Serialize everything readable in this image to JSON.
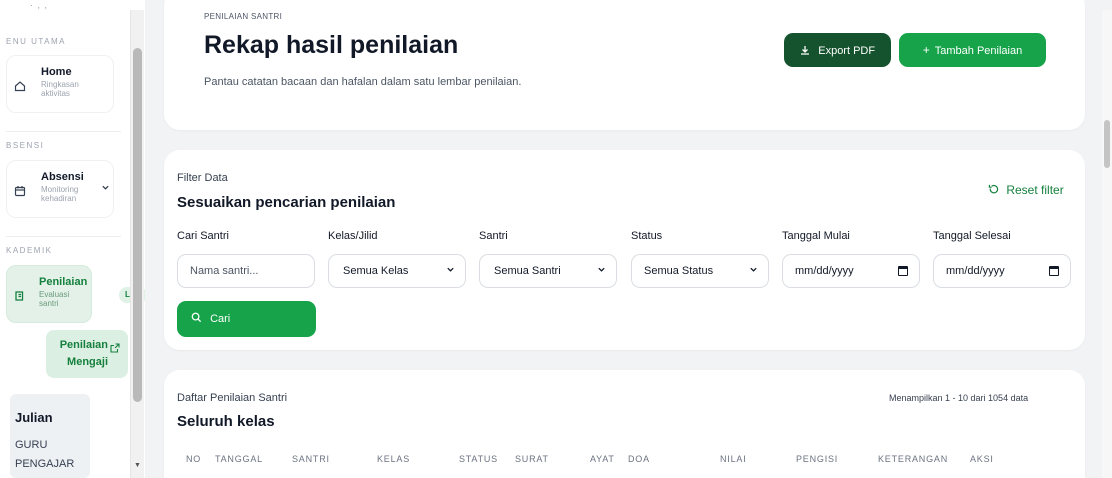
{
  "sidebar": {
    "top_fragment": "· , ,",
    "section_main": "ENU UTAMA",
    "home": {
      "title": "Home",
      "subtitle": "Ringkasan aktivitas",
      "icon": "home-icon"
    },
    "section_absensi": "BSENSI",
    "absensi": {
      "title": "Absensi",
      "subtitle": "Monitoring kehadiran",
      "icon": "calendar-icon"
    },
    "section_akademik": "KADEMIK",
    "penilaian": {
      "title": "Penilaian",
      "subtitle": "Evaluasi santri",
      "badge": "Live",
      "icon": "book-icon"
    },
    "sub_item": {
      "label": "Penilaian Mengaji",
      "icon": "external-link-icon"
    },
    "user": {
      "name": "Julian",
      "role": "GURU PENGAJAR"
    }
  },
  "header": {
    "eyebrow": "PENILAIAN SANTRI",
    "title": "Rekap hasil penilaian",
    "description": "Pantau catatan bacaan dan hafalan dalam satu lembar penilaian.",
    "export_label": "Export PDF",
    "add_label": "Tambah Penilaian"
  },
  "filter": {
    "eyebrow": "Filter Data",
    "title": "Sesuaikan pencarian penilaian",
    "reset_label": "Reset filter",
    "fields": {
      "cari_santri": {
        "label": "Cari Santri",
        "placeholder": "Nama santri..."
      },
      "kelas": {
        "label": "Kelas/Jilid",
        "value": "Semua Kelas"
      },
      "santri": {
        "label": "Santri",
        "value": "Semua Santri"
      },
      "status": {
        "label": "Status",
        "value": "Semua Status"
      },
      "tanggal_mulai": {
        "label": "Tanggal Mulai",
        "value": "mm/dd/yyyy"
      },
      "tanggal_selesai": {
        "label": "Tanggal Selesai",
        "value": "mm/dd/yyyy"
      }
    },
    "search_label": "Cari"
  },
  "list": {
    "eyebrow": "Daftar Penilaian Santri",
    "title": "Seluruh kelas",
    "count_text": "Menampilkan 1 - 10 dari 1054 data",
    "columns": [
      "NO",
      "TANGGAL",
      "SANTRI",
      "KELAS",
      "STATUS",
      "SURAT",
      "AYAT",
      "DOA",
      "NILAI",
      "PENGISI",
      "KETERANGAN",
      "AKSI"
    ]
  },
  "colors": {
    "primary": "#16a34a",
    "primary_dark": "#14532d",
    "active_bg": "#e3f1e8",
    "page_bg": "#f2f3f5"
  }
}
